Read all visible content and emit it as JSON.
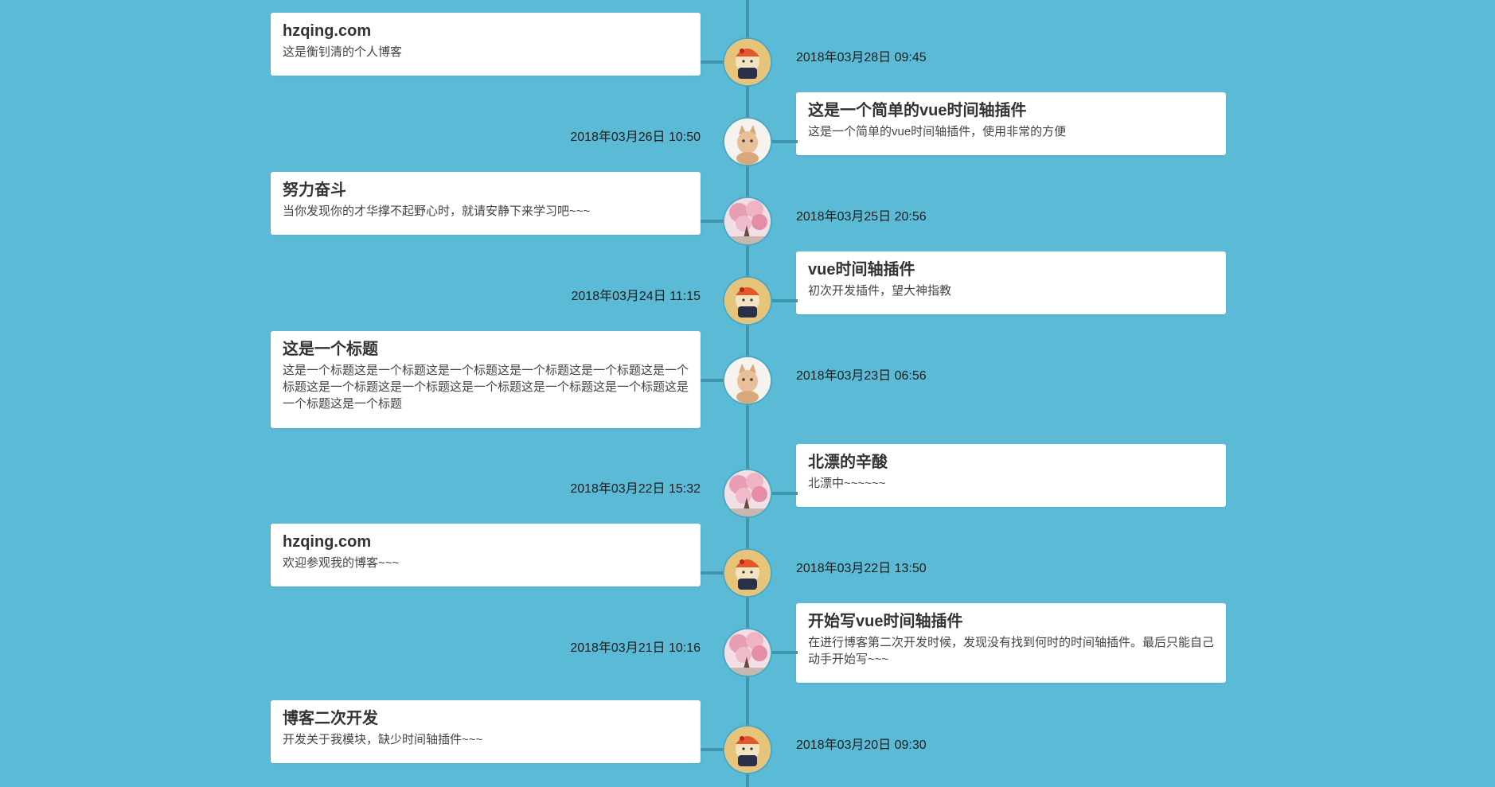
{
  "timeline": [
    {
      "title": "hzqing.com",
      "desc": "这是衡钊清的个人博客",
      "date": "2018年03月28日 09:45",
      "avatar": "cartoon-boy-icon"
    },
    {
      "title": "这是一个简单的vue时间轴插件",
      "desc": "这是一个简单的vue时间轴插件，使用非常的方便",
      "date": "2018年03月26日 10:50",
      "avatar": "cat-icon"
    },
    {
      "title": "努力奋斗",
      "desc": "当你发现你的才华撑不起野心时，就请安静下来学习吧~~~",
      "date": "2018年03月25日 20:56",
      "avatar": "cherry-blossom-icon"
    },
    {
      "title": "vue时间轴插件",
      "desc": "初次开发插件，望大神指教",
      "date": "2018年03月24日 11:15",
      "avatar": "cartoon-boy-icon"
    },
    {
      "title": "这是一个标题",
      "desc": "这是一个标题这是一个标题这是一个标题这是一个标题这是一个标题这是一个标题这是一个标题这是一个标题这是一个标题这是一个标题这是一个标题这是一个标题这是一个标题",
      "date": "2018年03月23日 06:56",
      "avatar": "cat-icon"
    },
    {
      "title": "北漂的辛酸",
      "desc": "北漂中~~~~~~",
      "date": "2018年03月22日 15:32",
      "avatar": "cherry-blossom-icon"
    },
    {
      "title": "hzqing.com",
      "desc": "欢迎参观我的博客~~~",
      "date": "2018年03月22日 13:50",
      "avatar": "cartoon-boy-icon"
    },
    {
      "title": "开始写vue时间轴插件",
      "desc": "在进行博客第二次开发时候，发现没有找到何时的时间轴插件。最后只能自己动手开始写~~~",
      "date": "2018年03月21日 10:16",
      "avatar": "cherry-blossom-icon"
    },
    {
      "title": "博客二次开发",
      "desc": "开发关于我模块，缺少时间轴插件~~~",
      "date": "2018年03月20日 09:30",
      "avatar": "cartoon-boy-icon"
    }
  ],
  "colors": {
    "background": "#5bbbd6",
    "axis": "#3f94ae",
    "card": "#ffffff"
  }
}
